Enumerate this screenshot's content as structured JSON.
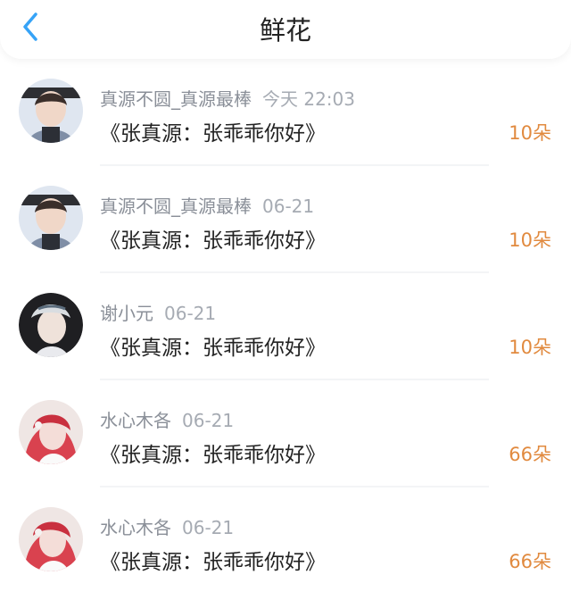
{
  "header": {
    "title": "鲜花",
    "back_icon": "chevron-left-icon"
  },
  "colors": {
    "accent_blue": "#36a3f7",
    "amount_orange": "#e18a3f"
  },
  "items": [
    {
      "username": "真源不圆_真源最棒",
      "time": "今天 22:03",
      "message": "《张真源：张乖乖你好》",
      "amount": "10朵"
    },
    {
      "username": "真源不圆_真源最棒",
      "time": "06-21",
      "message": "《张真源：张乖乖你好》",
      "amount": "10朵"
    },
    {
      "username": "谢小元",
      "time": "06-21",
      "message": "《张真源：张乖乖你好》",
      "amount": "10朵"
    },
    {
      "username": "水心木各",
      "time": "06-21",
      "message": "《张真源：张乖乖你好》",
      "amount": "66朵"
    },
    {
      "username": "水心木各",
      "time": "06-21",
      "message": "《张真源：张乖乖你好》",
      "amount": "66朵"
    }
  ]
}
